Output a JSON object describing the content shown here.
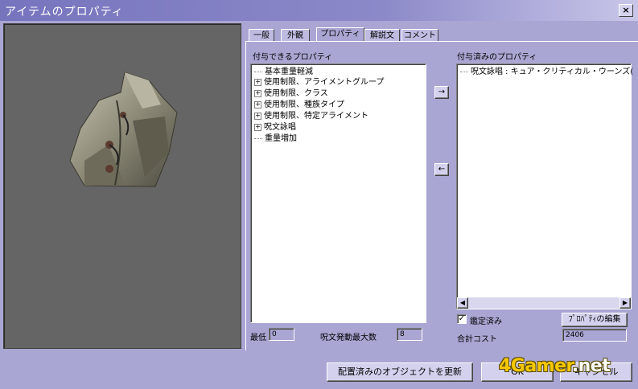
{
  "window": {
    "title": "アイテムのプロパティ",
    "close_label": "×"
  },
  "tabs": [
    {
      "label": "一般",
      "active": false
    },
    {
      "label": "外観",
      "active": false
    },
    {
      "label": "プロパティ",
      "active": true
    },
    {
      "label": "解説文",
      "active": false
    },
    {
      "label": "コメント",
      "active": false
    }
  ],
  "available": {
    "header": "付与できるプロパティ",
    "items": [
      {
        "label": "基本重量軽減",
        "expandable": false
      },
      {
        "label": "使用制限、アライメントグループ",
        "expandable": true
      },
      {
        "label": "使用制限、クラス",
        "expandable": true
      },
      {
        "label": "使用制限、種族タイプ",
        "expandable": true
      },
      {
        "label": "使用制限、特定アライメント",
        "expandable": true
      },
      {
        "label": "呪文詠唱",
        "expandable": true
      },
      {
        "label": "重量増加",
        "expandable": false
      }
    ]
  },
  "move_buttons": {
    "add": "→",
    "remove": "←"
  },
  "assigned": {
    "header": "付与済みのプロパティ",
    "items": [
      {
        "label": "呪文詠唱 : キュア・クリティカル・ウーンズ("
      }
    ]
  },
  "identified": {
    "label": "鑑定済み",
    "checked": true
  },
  "edit_property_button": "ﾌﾟﾛﾊﾟﾃｨの編集",
  "min_level": {
    "label": "最低",
    "value": "0"
  },
  "max_spell": {
    "label": "呪文発動最大数",
    "value": "8"
  },
  "total_cost": {
    "label": "合計コスト",
    "value": "2406"
  },
  "footer": {
    "update_button": "配置済みのオブジェクトを更新",
    "ok_button": "OK",
    "cancel_button": "キャンセル"
  },
  "watermark": {
    "main": "4Gamer",
    "suffix": ".net"
  }
}
